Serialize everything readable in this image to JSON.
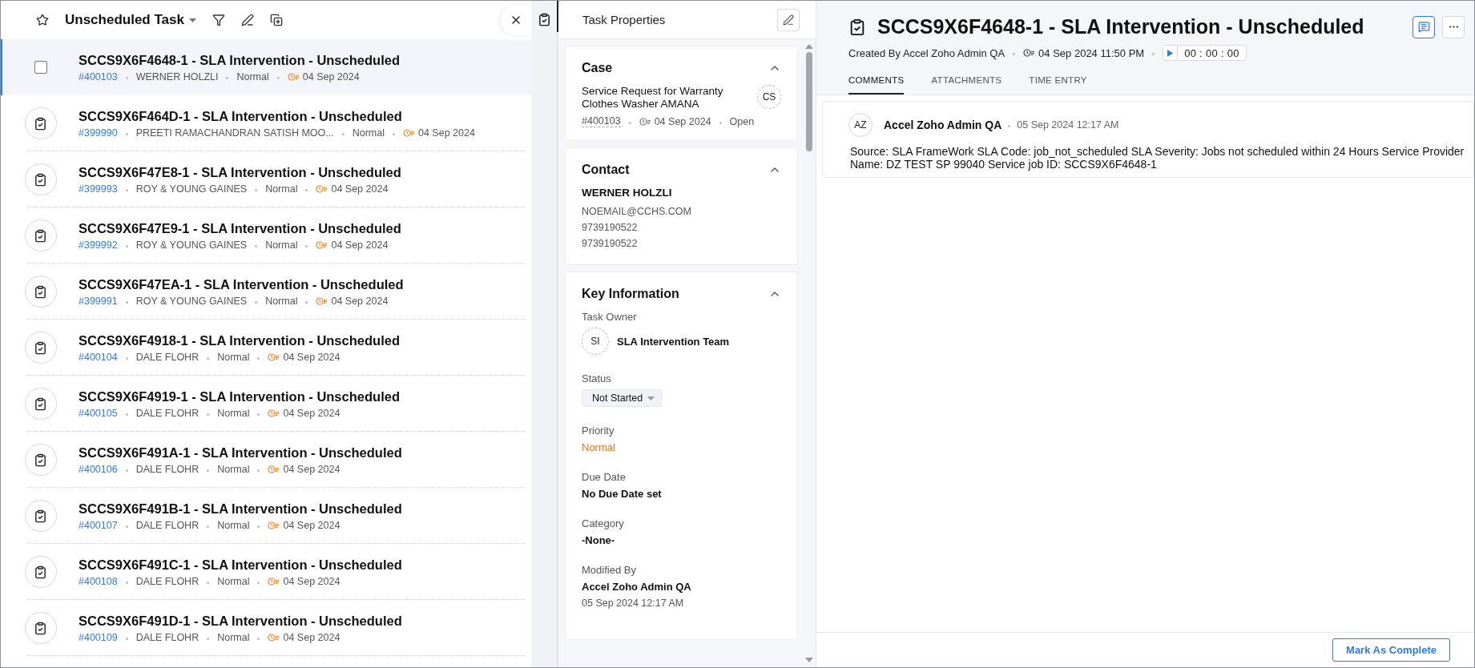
{
  "list": {
    "title": "Unscheduled Task",
    "rows": [
      {
        "title": "SCCS9X6F4648-1 - SLA Intervention - Unscheduled",
        "number": "#400103",
        "contact": "WERNER HOLZLI",
        "priority": "Normal",
        "date": "04 Sep 2024",
        "selected": true
      },
      {
        "title": "SCCS9X6F464D-1 - SLA Intervention - Unscheduled",
        "number": "#399990",
        "contact": "PREETI RAMACHANDRAN SATISH MOO...",
        "priority": "Normal",
        "date": "04 Sep 2024",
        "selected": false
      },
      {
        "title": "SCCS9X6F47E8-1 - SLA Intervention - Unscheduled",
        "number": "#399993",
        "contact": "ROY & YOUNG GAINES",
        "priority": "Normal",
        "date": "04 Sep 2024",
        "selected": false
      },
      {
        "title": "SCCS9X6F47E9-1 - SLA Intervention - Unscheduled",
        "number": "#399992",
        "contact": "ROY & YOUNG GAINES",
        "priority": "Normal",
        "date": "04 Sep 2024",
        "selected": false
      },
      {
        "title": "SCCS9X6F47EA-1 - SLA Intervention - Unscheduled",
        "number": "#399991",
        "contact": "ROY & YOUNG GAINES",
        "priority": "Normal",
        "date": "04 Sep 2024",
        "selected": false
      },
      {
        "title": "SCCS9X6F4918-1 - SLA Intervention - Unscheduled",
        "number": "#400104",
        "contact": "DALE FLOHR",
        "priority": "Normal",
        "date": "04 Sep 2024",
        "selected": false
      },
      {
        "title": "SCCS9X6F4919-1 - SLA Intervention - Unscheduled",
        "number": "#400105",
        "contact": "DALE FLOHR",
        "priority": "Normal",
        "date": "04 Sep 2024",
        "selected": false
      },
      {
        "title": "SCCS9X6F491A-1 - SLA Intervention - Unscheduled",
        "number": "#400106",
        "contact": "DALE FLOHR",
        "priority": "Normal",
        "date": "04 Sep 2024",
        "selected": false
      },
      {
        "title": "SCCS9X6F491B-1 - SLA Intervention - Unscheduled",
        "number": "#400107",
        "contact": "DALE FLOHR",
        "priority": "Normal",
        "date": "04 Sep 2024",
        "selected": false
      },
      {
        "title": "SCCS9X6F491C-1 - SLA Intervention - Unscheduled",
        "number": "#400108",
        "contact": "DALE FLOHR",
        "priority": "Normal",
        "date": "04 Sep 2024",
        "selected": false
      },
      {
        "title": "SCCS9X6F491D-1 - SLA Intervention - Unscheduled",
        "number": "#400109",
        "contact": "DALE FLOHR",
        "priority": "Normal",
        "date": "04 Sep 2024",
        "selected": false
      }
    ]
  },
  "properties": {
    "title": "Task Properties",
    "sections": [
      {
        "kind": "case",
        "heading": "Case",
        "expanded": true,
        "subject": "Service Request for Warranty Clothes Washer AMANA",
        "initials": "CS",
        "number": "#400103",
        "date": "04 Sep 2024",
        "status": "Open"
      },
      {
        "kind": "contact",
        "heading": "Contact",
        "expanded": true,
        "name": "WERNER HOLZLI",
        "lines": [
          "NOEMAIL@CCHS.COM",
          "9739190522",
          "9739190522"
        ]
      },
      {
        "kind": "fields",
        "heading": "Key Information",
        "expanded": true,
        "fields": [
          {
            "kind": "owner",
            "label": "Task Owner",
            "initials": "SI",
            "value": "SLA Intervention Team"
          },
          {
            "kind": "select",
            "label": "Status",
            "value": "Not Started"
          },
          {
            "kind": "priority",
            "label": "Priority",
            "value": "Normal"
          },
          {
            "kind": "text",
            "label": "Due Date",
            "value": "No Due Date set"
          },
          {
            "kind": "text",
            "label": "Category",
            "value": "-None-"
          },
          {
            "kind": "modified",
            "label": "Modified By",
            "value": "Accel Zoho Admin QA",
            "time": "05 Sep 2024 12:17 AM"
          }
        ]
      }
    ]
  },
  "detail": {
    "title": "SCCS9X6F4648-1 - SLA Intervention - Unscheduled",
    "created_by": "Created By Accel Zoho Admin QA",
    "created_at": "04 Sep 2024 11:50 PM",
    "timer": "00 : 00 : 00",
    "tabs": [
      {
        "label": "COMMENTS",
        "selected": true
      },
      {
        "label": "ATTACHMENTS",
        "selected": false
      },
      {
        "label": "TIME ENTRY",
        "selected": false
      }
    ],
    "comments": [
      {
        "initials": "AZ",
        "author": "Accel Zoho Admin QA",
        "time": "05 Sep 2024 12:17 AM",
        "text": "Source: SLA FrameWork SLA Code: job_not_scheduled SLA Severity: Jobs not scheduled within 24 Hours Service Provider Name: DZ TEST SP 99040 Service job ID: SCCS9X6F4648-1"
      }
    ],
    "action": "Mark As Complete"
  }
}
